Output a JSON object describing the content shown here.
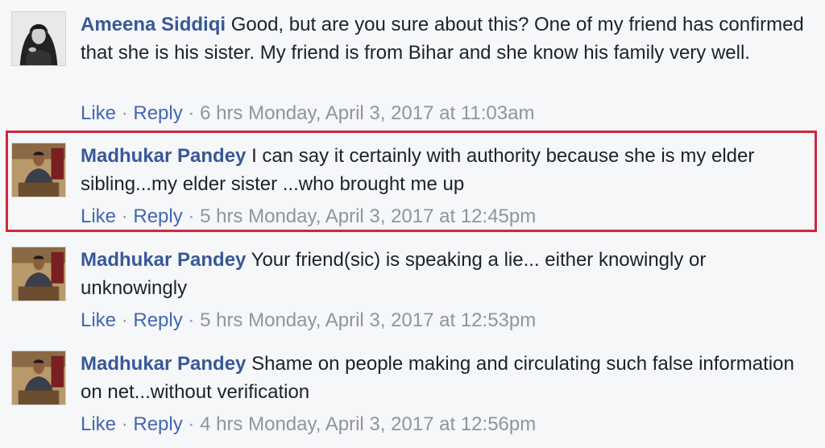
{
  "comments": [
    {
      "author": "Ameena Siddiqi",
      "text": "Good, but are you sure about this? One of my friend has confirmed that she is his sister. My friend is from Bihar and she know his family very well.",
      "like_label": "Like",
      "reply_label": "Reply",
      "separator": "·",
      "age": "6 hrs",
      "timestamp": "Monday, April 3, 2017 at 11:03am",
      "avatar_icon": "profile-photo-woman"
    },
    {
      "author": "Madhukar Pandey",
      "text": "I can say it certainly with authority because she is my elder sibling...my elder sister ...who brought me up",
      "like_label": "Like",
      "reply_label": "Reply",
      "separator": "·",
      "age": "5 hrs",
      "timestamp": "Monday, April 3, 2017 at 12:45pm",
      "avatar_icon": "profile-photo-man",
      "highlighted": true
    },
    {
      "author": "Madhukar Pandey",
      "text": "Your friend(sic) is speaking a lie... either knowingly or unknowingly",
      "like_label": "Like",
      "reply_label": "Reply",
      "separator": "·",
      "age": "5 hrs",
      "timestamp": "Monday, April 3, 2017 at 12:53pm",
      "avatar_icon": "profile-photo-man"
    },
    {
      "author": "Madhukar Pandey",
      "text": "Shame on people making and circulating such false information on net...without verification",
      "like_label": "Like",
      "reply_label": "Reply",
      "separator": "·",
      "age": "4 hrs",
      "timestamp": "Monday, April 3, 2017 at 12:56pm",
      "avatar_icon": "profile-photo-man"
    }
  ],
  "colors": {
    "author": "#385898",
    "link": "#4267b2",
    "meta": "#90949c",
    "highlight_border": "#d0273a",
    "background": "#f6f7f9"
  }
}
